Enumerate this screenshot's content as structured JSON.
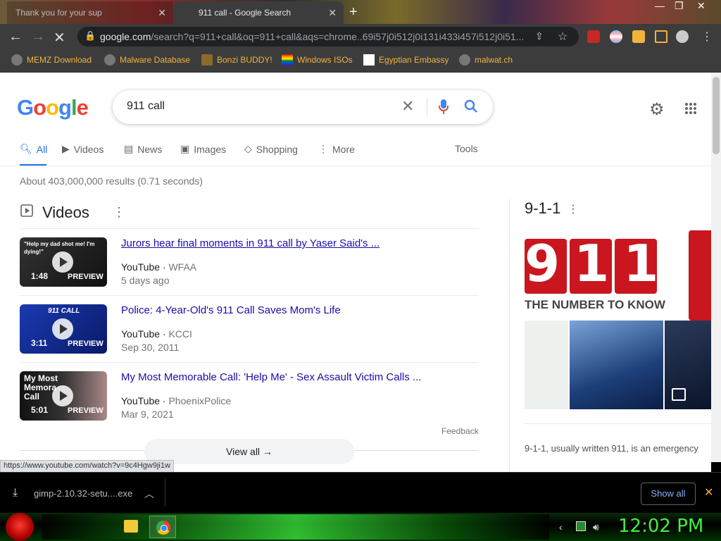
{
  "browser": {
    "tabs": [
      {
        "title": "Thank you for your sup"
      },
      {
        "title": "911 call - Google Search"
      }
    ],
    "url": "google.com",
    "url_rest": "/search?q=911+call&oq=911+call&aqs=chrome..69i57j0i512j0i131i433i457i512j0i51..."
  },
  "bookmarks": [
    {
      "label": "MEMZ Download"
    },
    {
      "label": "Malware Database"
    },
    {
      "label": "Bonzi BUDDY!"
    },
    {
      "label": "Windows ISOs"
    },
    {
      "label": "Egyptian Embassy"
    },
    {
      "label": "malwat.ch"
    }
  ],
  "google": {
    "logo": "Google",
    "query": "911 call",
    "tabs": [
      "All",
      "Videos",
      "News",
      "Images",
      "Shopping",
      "More"
    ],
    "tools": "Tools",
    "stats": "About 403,000,000 results (0.71 seconds)",
    "videos_heading": "Videos",
    "videos": [
      {
        "title": "Jurors hear final moments in 911 call by Yaser Said's ...",
        "source": "YouTube",
        "channel": "WFAA",
        "date": "5 days ago",
        "duration": "1:48",
        "preview": "PREVIEW",
        "thumb_text": "\"Help my dad shot me! I'm dying!\""
      },
      {
        "title": "Police: 4-Year-Old's 911 Call Saves Mom's Life",
        "source": "YouTube",
        "channel": "KCCI",
        "date": "Sep 30, 2011",
        "duration": "3:11",
        "preview": "PREVIEW",
        "thumb_text": "911 CALL"
      },
      {
        "title": "My Most Memorable Call: 'Help Me' - Sex Assault Victim Calls ...",
        "source": "YouTube",
        "channel": "PhoenixPolice",
        "date": "Mar 9, 2021",
        "duration": "5:01",
        "preview": "PREVIEW",
        "thumb_text": "My Most Memora Call"
      }
    ],
    "feedback": "Feedback",
    "view_all": "View all",
    "knowledge_panel": {
      "title": "9-1-1",
      "logo_text": "911",
      "logo_sub": "THE NUMBER TO KNOW",
      "description": "9-1-1, usually written 911, is an emergency"
    }
  },
  "status_url": "https://www.youtube.com/watch?v=9c4Hgw9ji1w",
  "download": {
    "filename": "gimp-2.10.32-setu....exe",
    "show_all": "Show all"
  },
  "taskbar": {
    "clock": "12:02 PM"
  },
  "colors": {
    "accent": "#1a73e8",
    "link": "#1a0dab",
    "bookmark": "#f2b33d",
    "clock": "#3ef03e"
  }
}
